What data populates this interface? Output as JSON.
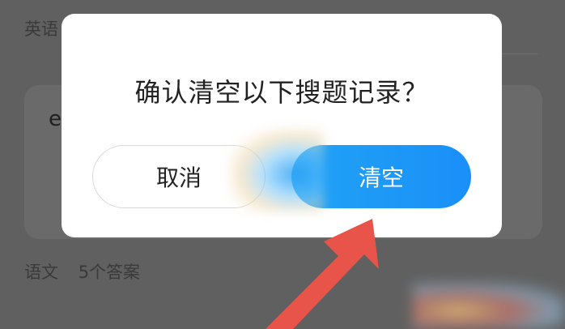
{
  "background": {
    "subject_top": "英语",
    "card_char": "e",
    "subject_bottom": "语文",
    "answer_count": "5个答案"
  },
  "dialog": {
    "title": "确认清空以下搜题记录？",
    "cancel_label": "取消",
    "confirm_label": "清空"
  },
  "colors": {
    "overlay": "#606060",
    "dialog_bg": "#ffffff",
    "confirm_start": "#20a3f5",
    "confirm_end": "#1a8ff8",
    "arrow": "#e8534a"
  },
  "icons": [
    "pointer-arrow-icon"
  ]
}
